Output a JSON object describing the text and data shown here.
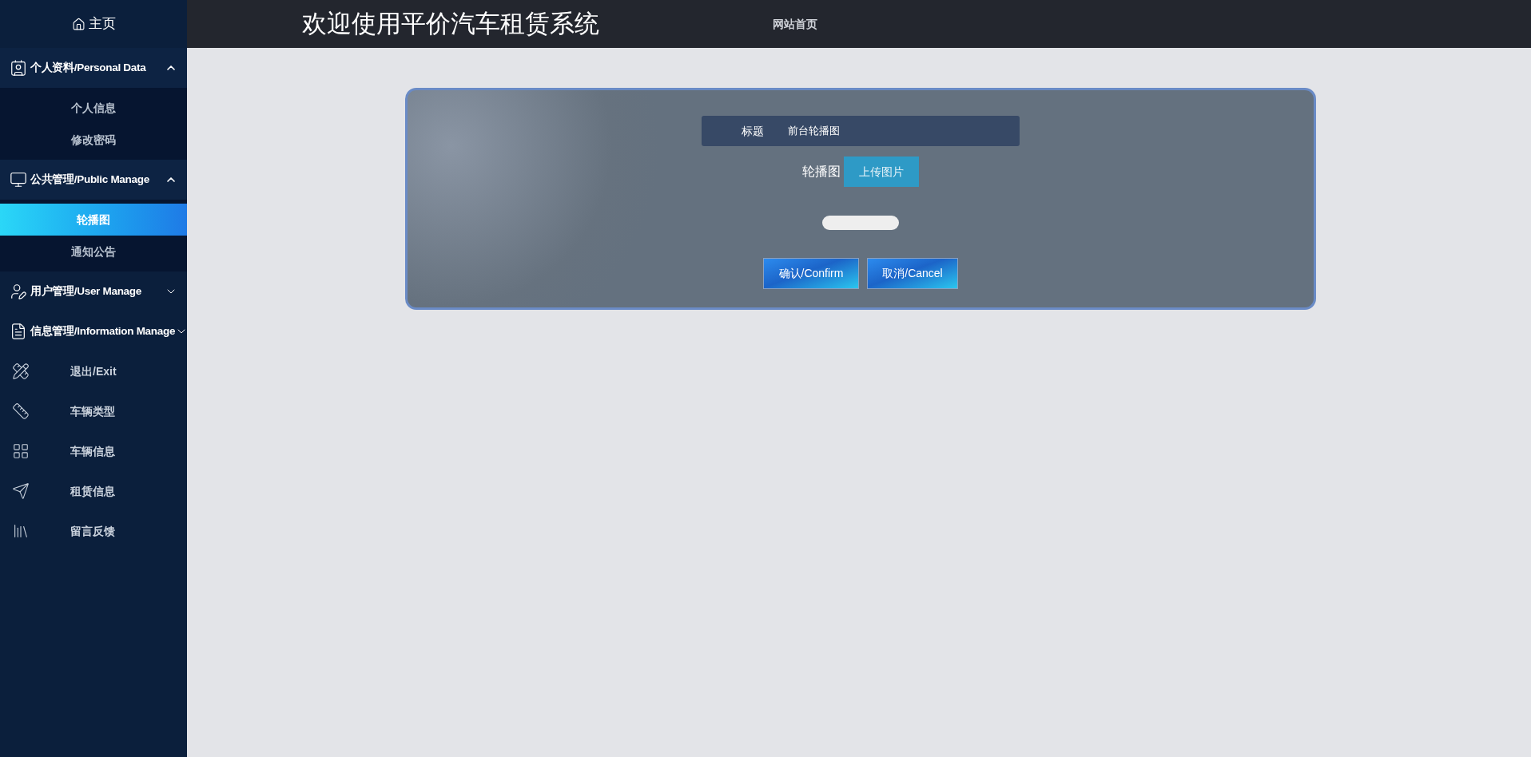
{
  "sidebar": {
    "home": "主页",
    "groups": [
      {
        "label": "个人资料/Personal Data",
        "expanded": true,
        "children": [
          {
            "label": "个人信息",
            "selected": false
          },
          {
            "label": "修改密码",
            "selected": false
          }
        ]
      },
      {
        "label": "公共管理/Public Manage",
        "expanded": true,
        "children": [
          {
            "label": "轮播图",
            "selected": true
          },
          {
            "label": "通知公告",
            "selected": false
          }
        ]
      },
      {
        "label": "用户管理/User Manage",
        "expanded": false
      },
      {
        "label": "信息管理/Information Manage",
        "expanded": false
      }
    ],
    "items": [
      {
        "label": "退出/Exit"
      },
      {
        "label": "车辆类型"
      },
      {
        "label": "车辆信息"
      },
      {
        "label": "租赁信息"
      },
      {
        "label": "留言反馈"
      }
    ]
  },
  "header": {
    "title": "欢迎使用平价汽车租赁系统",
    "link": "网站首页"
  },
  "form": {
    "title_label": "标题",
    "title_value": "前台轮播图",
    "image_label": "轮播图",
    "upload_button": "上传图片",
    "confirm": "确认/Confirm",
    "cancel": "取消/Cancel"
  }
}
